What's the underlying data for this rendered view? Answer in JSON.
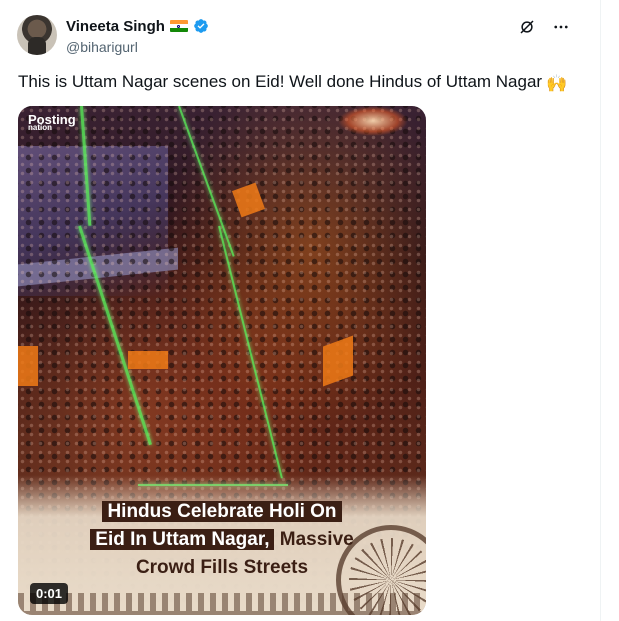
{
  "author": {
    "name": "Vineeta Singh",
    "handle": "@biharigurl",
    "flag_icon": "india-flag-icon",
    "verified_color": "#1d9bf0"
  },
  "tweet": {
    "text": "This is Uttam Nagar scenes on Eid! Well done Hindus of Uttam Nagar",
    "emoji": "🙌"
  },
  "media": {
    "logo_line1": "Posting",
    "logo_line2": "nation",
    "caption_line1": "Hindus Celebrate Holi On",
    "caption_line2_highlight": "Eid In Uttam Nagar,",
    "caption_line2_rest": " Massive",
    "caption_line3": "Crowd Fills Streets",
    "duration": "0:01"
  },
  "icons": {
    "grok": "grok-icon",
    "more": "more-icon"
  }
}
